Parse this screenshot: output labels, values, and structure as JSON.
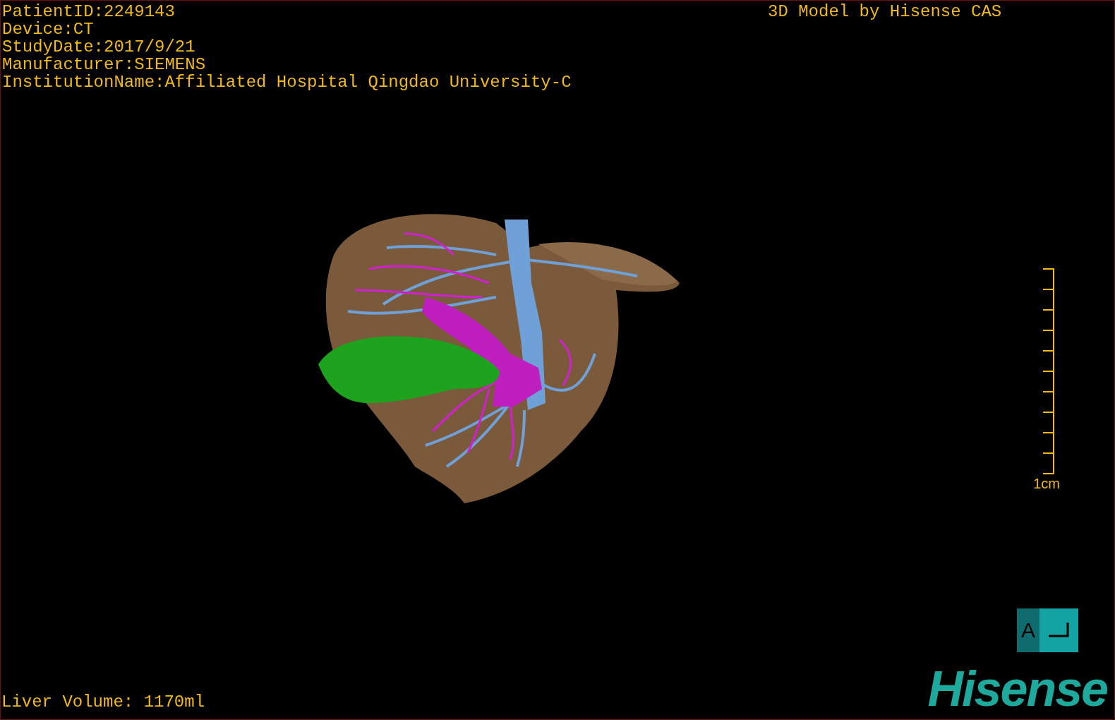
{
  "study_info": [
    "PatientID:2249143",
    "Device:CT",
    "StudyDate:2017/9/21",
    "Manufacturer:SIEMENS",
    "InstitutionName:Affiliated Hospital Qingdao University-C"
  ],
  "title": "3D Model by Hisense CAS",
  "scale_bar": {
    "label": "1cm"
  },
  "orientation_marker": {
    "label": "A"
  },
  "logo": {
    "text": "Hisense"
  },
  "liver_volume": "Liver Volume: 1170ml"
}
